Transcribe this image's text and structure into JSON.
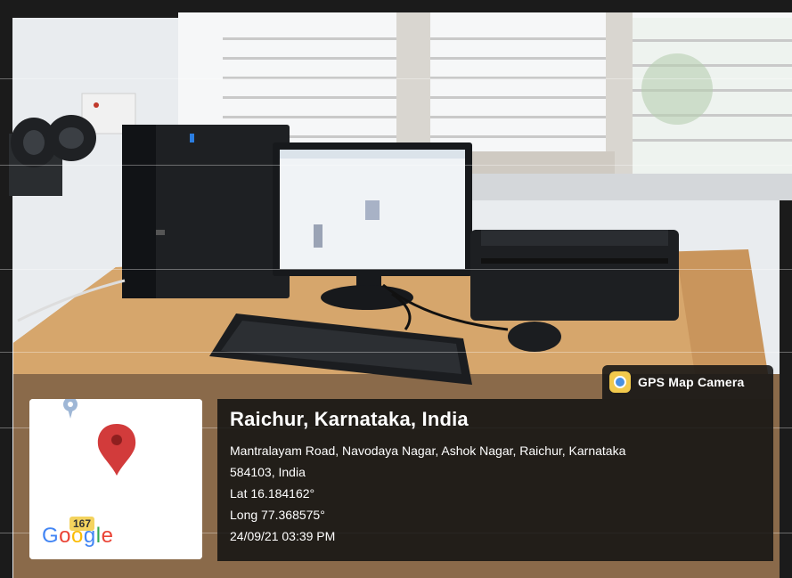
{
  "badge": {
    "label": "GPS Map Camera"
  },
  "map": {
    "road_number": "167",
    "google_logo": "Google"
  },
  "location": {
    "title": "Raichur, Karnataka, India",
    "address_line1": "Mantralayam Road, Navodaya Nagar, Ashok Nagar, Raichur, Karnataka",
    "address_line2": "584103, India",
    "lat": "Lat 16.184162°",
    "long": "Long 77.368575°",
    "datetime": "24/09/21 03:39 PM"
  },
  "icons": {
    "pin": "map-pin-icon",
    "google_pin": "location-marker-icon",
    "camera_app": "gps-camera-app-icon"
  }
}
